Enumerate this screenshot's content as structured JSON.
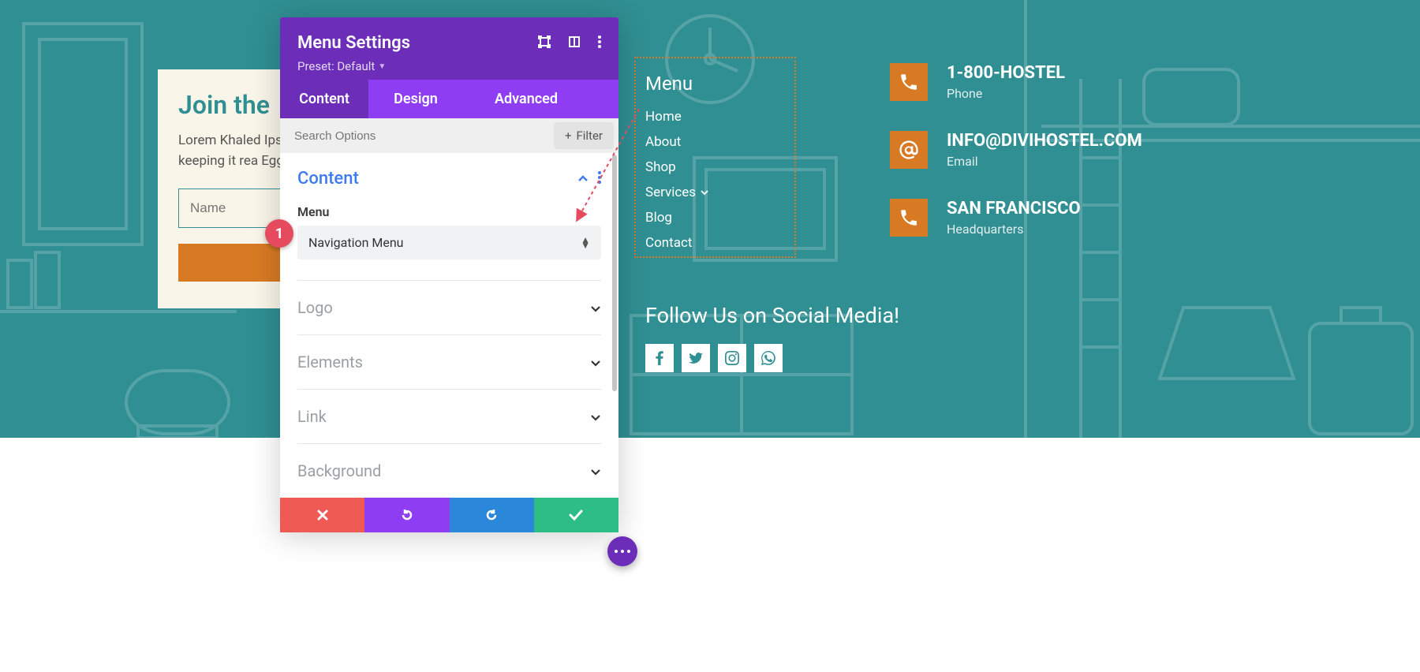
{
  "join_card": {
    "title": "Join the",
    "body": "Lorem Khaled Ipsu do know, you do I'm keeping it rea Egg whites, turke",
    "name_placeholder": "Name"
  },
  "settings": {
    "title": "Menu Settings",
    "preset_label": "Preset: Default",
    "tabs": {
      "content": "Content",
      "design": "Design",
      "advanced": "Advanced"
    },
    "search_placeholder": "Search Options",
    "filter_label": "Filter",
    "section_content": "Content",
    "field_menu_label": "Menu",
    "menu_select_value": "Navigation Menu",
    "collapsed": {
      "logo": "Logo",
      "elements": "Elements",
      "link": "Link",
      "background": "Background"
    }
  },
  "badge": {
    "number": "1"
  },
  "menu": {
    "title": "Menu",
    "items": [
      {
        "label": "Home",
        "children": false
      },
      {
        "label": "About",
        "children": false
      },
      {
        "label": "Shop",
        "children": false
      },
      {
        "label": "Services",
        "children": true
      },
      {
        "label": "Blog",
        "children": false
      },
      {
        "label": "Contact",
        "children": false
      }
    ]
  },
  "contacts": [
    {
      "value": "1-800-HOSTEL",
      "label": "Phone",
      "icon": "phone"
    },
    {
      "value": "INFO@DIVIHOSTEL.COM",
      "label": "Email",
      "icon": "at"
    },
    {
      "value": "SAN FRANCISCO",
      "label": "Headquarters",
      "icon": "phone"
    }
  ],
  "social": {
    "title": "Follow Us on Social Media!",
    "icons": [
      "facebook",
      "twitter",
      "instagram",
      "whatsapp"
    ]
  }
}
